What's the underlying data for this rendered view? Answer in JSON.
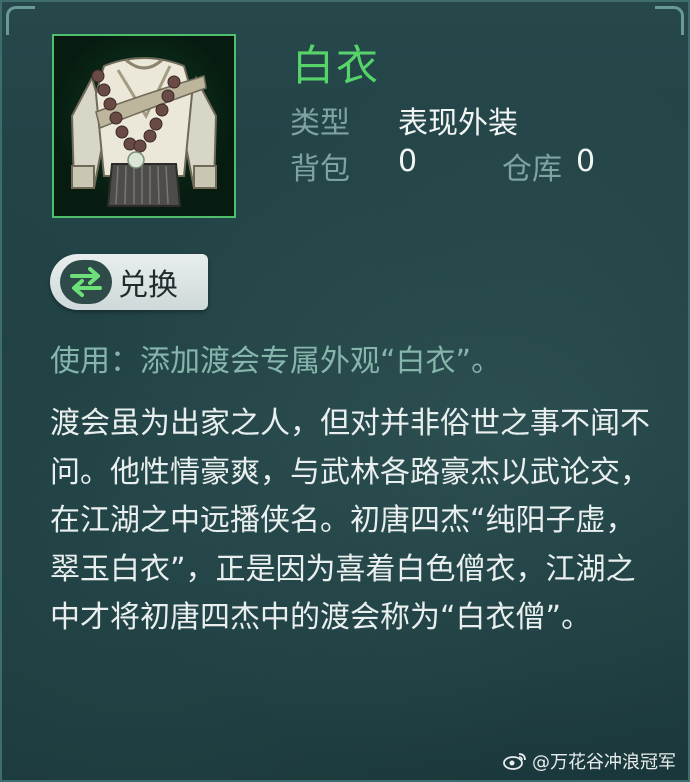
{
  "item": {
    "name": "白衣",
    "icon": "white-robe-garment-icon",
    "type_label": "类型",
    "type_value": "表现外装",
    "bag_label": "背包",
    "bag_count": "0",
    "warehouse_label": "仓库",
    "warehouse_count": "0"
  },
  "exchange_button": {
    "label": "兑换",
    "icon": "swap-arrows-icon"
  },
  "usage_text": "使用：添加渡会专属外观“白衣”。",
  "description": "渡会虽为出家之人，但对并非俗世之事不闻不问。他性情豪爽，与武林各路豪杰以武论交，在江湖之中远播侠名。初唐四杰“纯阳子虚，翠玉白衣”，正是因为喜着白色僧衣，江湖之中才将初唐四杰中的渡会称为“白衣僧”。",
  "watermark": "@万花谷冲浪冠军",
  "colors": {
    "name": "#56d46a",
    "frame": "#4fbf6d",
    "usage": "#86b5ac",
    "label": "#7fa3a0"
  }
}
